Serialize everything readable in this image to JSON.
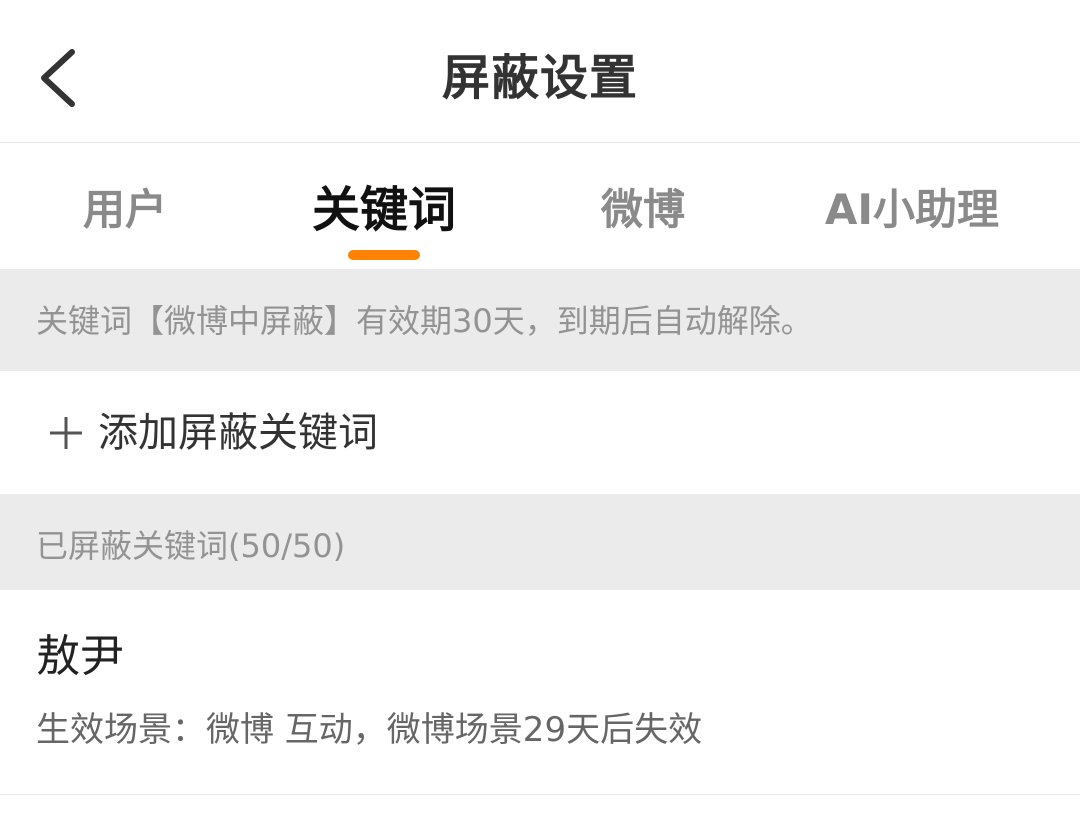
{
  "header": {
    "title": "屏蔽设置",
    "back_icon": "chevron-left-icon"
  },
  "tabs": [
    {
      "label": "用户",
      "active": false
    },
    {
      "label": "关键词",
      "active": true
    },
    {
      "label": "微博",
      "active": false
    },
    {
      "label": "AI小助理",
      "active": false
    }
  ],
  "notice": {
    "text": "关键词【微博中屏蔽】有效期30天，到期后自动解除。"
  },
  "add_keyword": {
    "icon": "plus-icon",
    "label": "添加屏蔽关键词"
  },
  "blocked_section": {
    "title": "已屏蔽关键词(50/50)"
  },
  "keywords": [
    {
      "name": "敖尹",
      "description": "生效场景：微博 互动，微博场景29天后失效"
    }
  ],
  "colors": {
    "accent": "#ff8200",
    "section_bg": "#ebebeb",
    "muted_text": "#939393"
  }
}
